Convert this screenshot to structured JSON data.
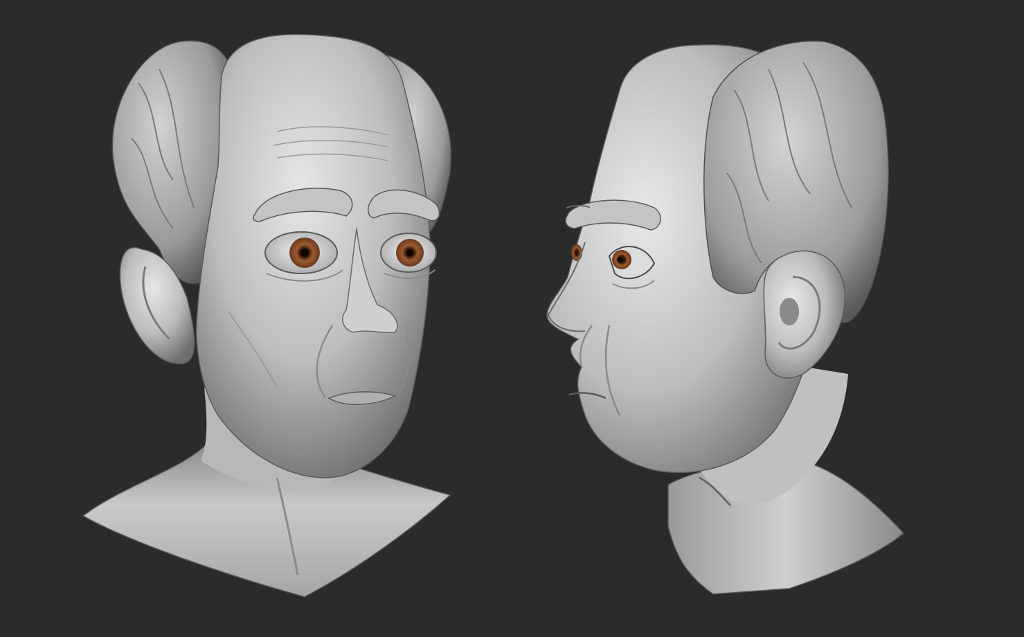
{
  "scene": {
    "background_color": "#2b2b2b",
    "material_color": "#c8c8c8",
    "eye_iris_color": "#9a5a32",
    "views": [
      {
        "view": "front-three-quarter"
      },
      {
        "view": "profile-facing-left"
      }
    ]
  }
}
